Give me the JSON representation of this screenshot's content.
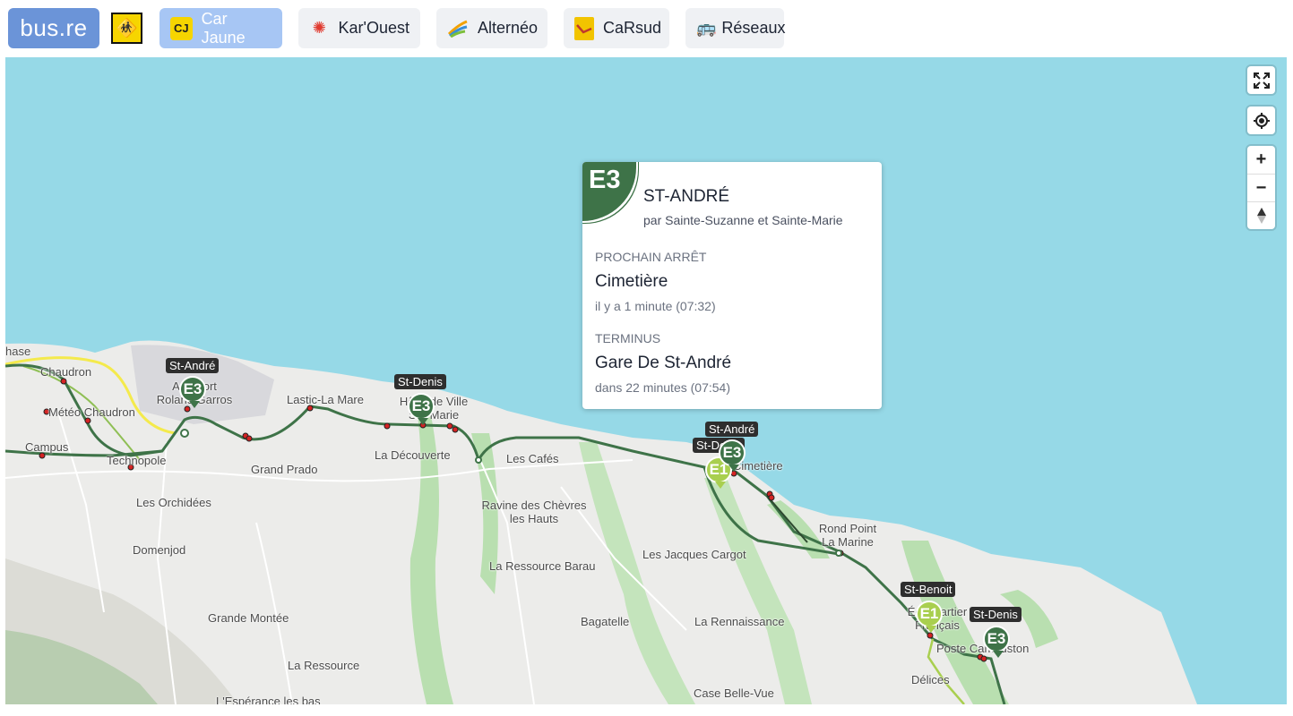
{
  "header": {
    "logo": "bus.re",
    "tabs": [
      {
        "label": "Car Jaune",
        "icon": "car-jaune-logo-icon",
        "active": true
      },
      {
        "label": "Kar'Ouest",
        "icon": "karouest-logo-icon",
        "active": false
      },
      {
        "label": "Alternéo",
        "icon": "alterneo-logo-icon",
        "active": false
      },
      {
        "label": "CaRsud",
        "icon": "carsud-logo-icon",
        "active": false
      },
      {
        "label": "Réseaux",
        "icon": "bus-icon",
        "active": false
      }
    ]
  },
  "map": {
    "places": [
      "hase",
      "Chaudron",
      "Météo Chaudron",
      "Campus",
      "Technopole",
      "Aéroport Roland Garros",
      "Lastic-La Mare",
      "Hôtel de Ville Ste-Marie",
      "La Découverte",
      "Grand Prado",
      "Les Cafés",
      "Les Orchidées",
      "Ravine des Chèvres les Hauts",
      "Domenjod",
      "La Ressource Barau",
      "Les Jacques Cargot",
      "Cimetière",
      "Rond Point La Marine",
      "Grande Montée",
      "Bagatelle",
      "La Rennaissance",
      "La Ressource",
      "Écoquartier Français",
      "Poste Cambuston",
      "Délices",
      "Case Belle-Vue",
      "L'Espérance les bas"
    ],
    "vehicles": [
      {
        "line": "E3",
        "direction": "St-André"
      },
      {
        "line": "E3",
        "direction": "St-Denis"
      },
      {
        "line": "E3",
        "direction": "St-André"
      },
      {
        "line": "E1",
        "direction": "St-Denis"
      },
      {
        "line": "E1",
        "direction": "St-Benoit"
      },
      {
        "line": "E3",
        "direction": "St-Denis"
      }
    ],
    "line_colors": {
      "E3": "#3e7348",
      "E1": "#a9cf4f",
      "sea": "#96d9e7",
      "land": "#ececea",
      "vegetation": "#b9dfb0"
    }
  },
  "popup": {
    "line": "E3",
    "destination": "ST-ANDRÉ",
    "via": "par Sainte-Suzanne et Sainte-Marie",
    "next_stop_label": "PROCHAIN ARRÊT",
    "next_stop": "Cimetière",
    "next_stop_time": "il y a 1 minute (07:32)",
    "terminus_label": "TERMINUS",
    "terminus": "Gare De St-André",
    "terminus_time": "dans 22 minutes (07:54)"
  },
  "controls": [
    "fullscreen-icon",
    "geolocate-icon",
    "zoom-in-icon",
    "zoom-out-icon",
    "compass-icon"
  ]
}
